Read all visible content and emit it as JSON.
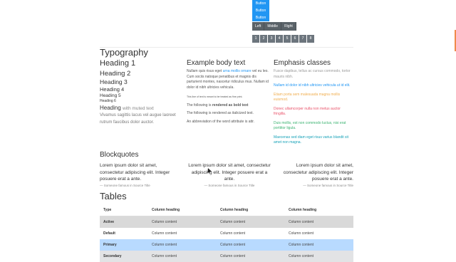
{
  "top": {
    "vbuttons": [
      "Button",
      "Button",
      "Button"
    ],
    "segmented": [
      "Left",
      "Middle",
      "Right"
    ],
    "pagination": [
      "1",
      "2",
      "3",
      "4",
      "5",
      "6",
      "7",
      "8"
    ]
  },
  "typography": {
    "title": "Typography",
    "h1": "Heading 1",
    "h2": "Heading 2",
    "h3": "Heading 3",
    "h4": "Heading 4",
    "h5": "Heading 5",
    "h6": "Heading 6",
    "muted_main": "Heading",
    "muted_sub": "with muted text",
    "lead": "Vivamus sagittis lacus vel augue laoreet rutrum faucibus dolor auctor."
  },
  "body_text": {
    "title": "Example body text",
    "para_pre": "Nullam quis risus eget",
    "para_link": "urna mollis ornare",
    "para_post": "vel eu leo. Cum sociis natoque penatibus et magnis dis parturient montes, nascetur ridiculus mus. Nullam id dolor id nibh ultricies vehicula.",
    "fine_print": "This line of text is meant to be treated as fine print.",
    "bold_pre": "The following is",
    "bold_word": "rendered as bold text",
    "italic_line": "The following is rendered as italicized text.",
    "abbr_line": "An abbreviation of the word attribute is attr."
  },
  "emphasis": {
    "title": "Emphasis classes",
    "lines": [
      "Fusce dapibus, tellus ac cursus commodo, tortor mauris nibh.",
      "Nullam id dolor id nibh ultricies vehicula ut id elit.",
      "Etiam porta sem malesuada magna mollis euismod.",
      "Donec ullamcorper nulla non metus auctor fringilla.",
      "Duis mollis, est non commodo luctus, nisi erat porttitor ligula.",
      "Maecenas sed diam eget risus varius blandit sit amet non magna."
    ]
  },
  "blockquotes": {
    "title": "Blockquotes",
    "quote": "Lorem ipsum dolor sit amet, consectetur adipiscing elit. Integer posuere erat a ante.",
    "footer": "— Someone famous in Source Title"
  },
  "tables": {
    "title": "Tables",
    "headers": [
      "Type",
      "Column heading",
      "Column heading",
      "Column heading"
    ],
    "rows": [
      {
        "type": "Active",
        "cells": [
          "Column content",
          "Column content",
          "Column content"
        ]
      },
      {
        "type": "Default",
        "cells": [
          "Column content",
          "Column content",
          "Column content"
        ]
      },
      {
        "type": "Primary",
        "cells": [
          "Column content",
          "Column content",
          "Column content"
        ]
      },
      {
        "type": "Secondary",
        "cells": [
          "Column content",
          "Column content",
          "Column content"
        ]
      }
    ]
  },
  "colors": {
    "accent": "#2196f3",
    "warning": "#f0ad4e",
    "danger": "#e9536a",
    "success": "#3cb371",
    "info": "#17a2b8"
  }
}
